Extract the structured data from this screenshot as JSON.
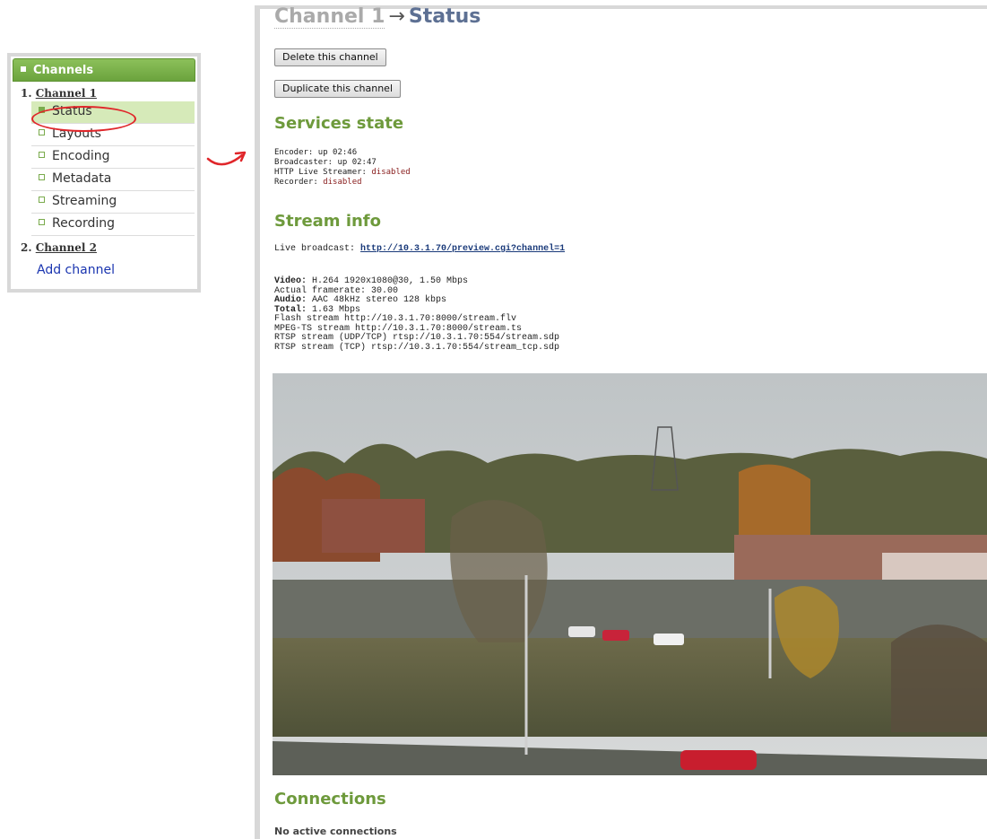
{
  "sidebar": {
    "header": "Channels",
    "channel1": {
      "number": "1.",
      "name": "Channel 1"
    },
    "items": [
      {
        "label": "Status"
      },
      {
        "label": "Layouts"
      },
      {
        "label": "Encoding"
      },
      {
        "label": "Metadata"
      },
      {
        "label": "Streaming"
      },
      {
        "label": "Recording"
      }
    ],
    "channel2": {
      "number": "2.",
      "name": "Channel 2"
    },
    "add_channel": "Add channel"
  },
  "page": {
    "title_channel": "Channel 1",
    "title_arrow": "→",
    "title_page": "Status"
  },
  "buttons": {
    "delete": "Delete this channel",
    "duplicate": "Duplicate this channel"
  },
  "services": {
    "heading": "Services state",
    "encoder_label": "Encoder:",
    "encoder_value": "up 02:46",
    "broadcaster_label": "Broadcaster:",
    "broadcaster_value": "up 02:47",
    "hls_label": "HTTP Live Streamer:",
    "hls_value": "disabled",
    "recorder_label": "Recorder:",
    "recorder_value": "disabled"
  },
  "stream": {
    "heading": "Stream info",
    "live_label": "Live broadcast:",
    "live_url": "http://10.3.1.70/preview.cgi?channel=1",
    "video_label": "Video:",
    "video_value": "H.264 1920x1080@30, 1.50 Mbps",
    "framerate": "Actual framerate: 30.00",
    "audio_label": "Audio:",
    "audio_value": "AAC 48kHz stereo 128 kbps",
    "total_label": "Total:",
    "total_value": "1.63 Mbps",
    "flash": "Flash stream http://10.3.1.70:8000/stream.flv",
    "mpegts": "MPEG-TS stream http://10.3.1.70:8000/stream.ts",
    "rtsp_udp": "RTSP stream (UDP/TCP) rtsp://10.3.1.70:554/stream.sdp",
    "rtsp_tcp": "RTSP stream (TCP) rtsp://10.3.1.70:554/stream_tcp.sdp"
  },
  "connections": {
    "heading": "Connections",
    "status": "No active connections"
  },
  "colors": {
    "accent_green": "#6e9a3c",
    "active_item": "#d6eab9",
    "annotation_red": "#e0262a",
    "title_blue": "#5d7093"
  }
}
